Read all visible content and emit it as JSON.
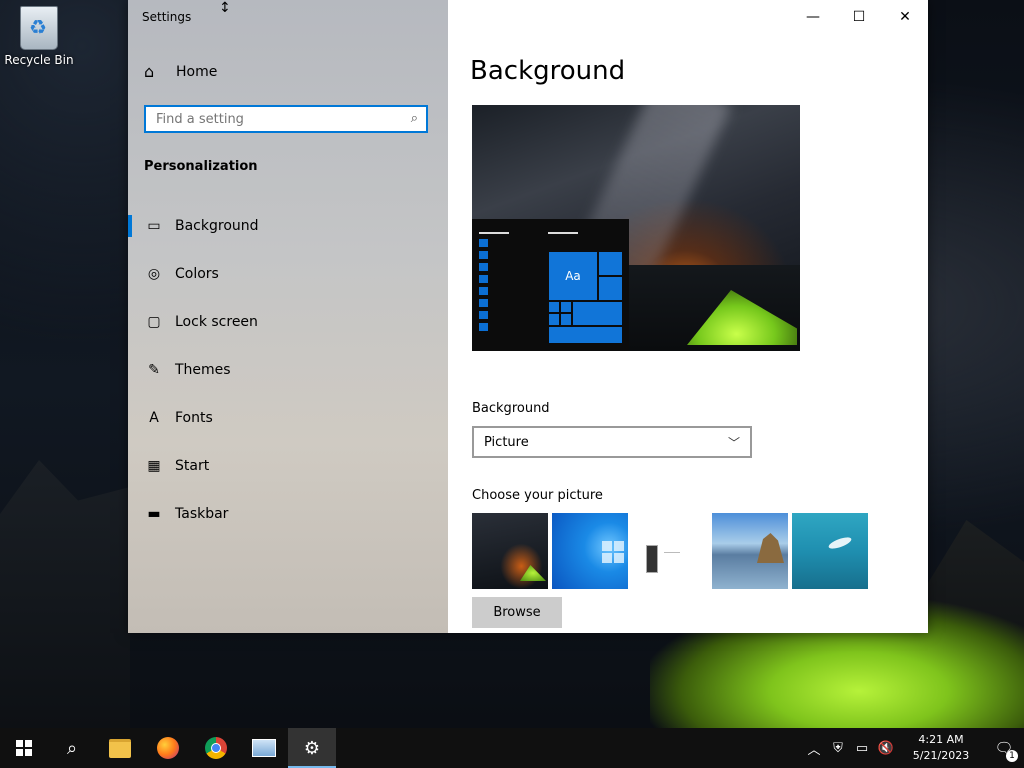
{
  "desktop": {
    "recycle_bin_label": "Recycle Bin"
  },
  "window": {
    "title": "Settings",
    "minimize_glyph": "—",
    "maximize_glyph": "☐",
    "close_glyph": "✕"
  },
  "sidebar": {
    "home_label": "Home",
    "search_placeholder": "Find a setting",
    "section_title": "Personalization",
    "items": [
      {
        "label": "Background",
        "icon": "picture-icon",
        "active": true
      },
      {
        "label": "Colors",
        "icon": "palette-icon",
        "active": false
      },
      {
        "label": "Lock screen",
        "icon": "lock-screen-icon",
        "active": false
      },
      {
        "label": "Themes",
        "icon": "brush-icon",
        "active": false
      },
      {
        "label": "Fonts",
        "icon": "font-icon",
        "active": false
      },
      {
        "label": "Start",
        "icon": "start-tiles-icon",
        "active": false
      },
      {
        "label": "Taskbar",
        "icon": "taskbar-icon",
        "active": false
      }
    ]
  },
  "content": {
    "page_title": "Background",
    "preview_tile_text": "Aa",
    "background_label": "Background",
    "background_value": "Picture",
    "choose_label": "Choose your picture",
    "browse_label": "Browse"
  },
  "taskbar": {
    "time": "4:21 AM",
    "date": "5/21/2023",
    "notification_count": "1",
    "accent_color": "#0078d7"
  }
}
